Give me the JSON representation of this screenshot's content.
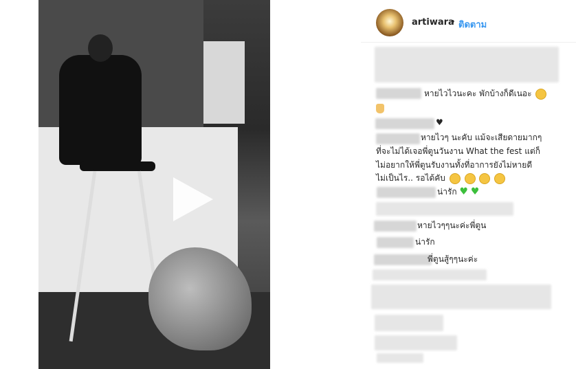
{
  "post": {
    "username": "artiwara",
    "separator": "•",
    "follow_label": "ติดตาม"
  },
  "comments": [
    {
      "text": "หายไวไวนะคะ พักบ้างก็ดีเนอะ"
    },
    {
      "text": "♥"
    },
    {
      "lines": [
        "หายไวๆ นะคับ แม้จะเสียดายมากๆ",
        "ที่จะไม่ได้เจอพี่ตูนวันงาน What the fest แต่ก็",
        "ไม่อยากให้พี่ตูนรับงานทั้งที่อาการยังไม่หายดี",
        "ไม่เป็นไร.. รอได้คับ"
      ]
    },
    {
      "text": "น่ารัก"
    },
    {
      "text": "หายไวๆๆนะค่ะพี่ตูน"
    },
    {
      "text": "น่ารัก"
    },
    {
      "text": "พี่ตูนสู้ๆๆนะค่ะ"
    }
  ],
  "icons": {
    "play": "play-icon",
    "smile": "smile-emoji",
    "heart": "heart-emoji"
  },
  "colors": {
    "accent": "#3897f0",
    "text": "#262626"
  }
}
